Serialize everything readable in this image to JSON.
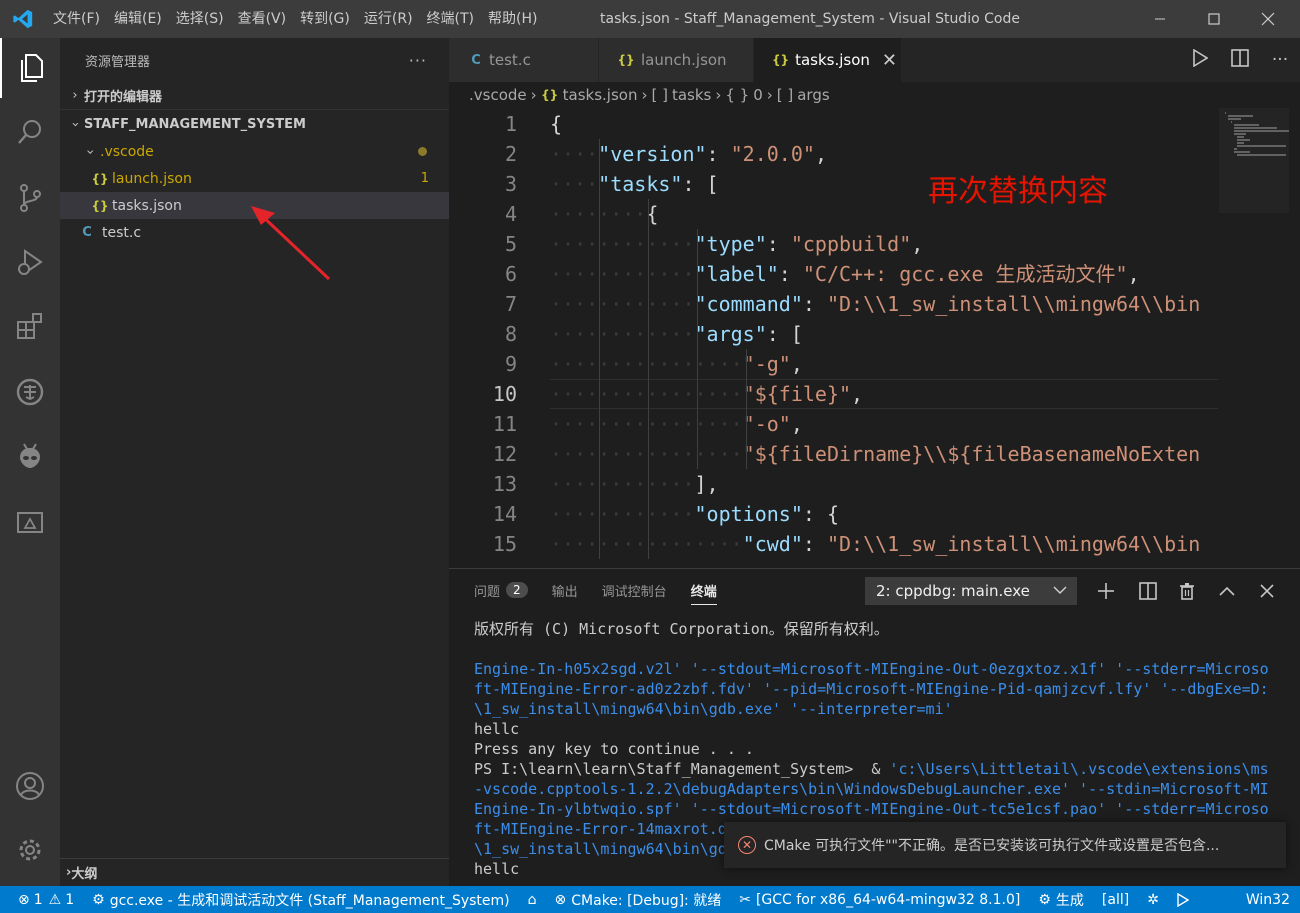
{
  "window": {
    "title": "tasks.json - Staff_Management_System - Visual Studio Code",
    "menu": [
      "文件(F)",
      "编辑(E)",
      "选择(S)",
      "查看(V)",
      "转到(G)",
      "运行(R)",
      "终端(T)",
      "帮助(H)"
    ]
  },
  "activity_bar": [
    "explorer-icon",
    "search-icon",
    "source-control-icon",
    "run-debug-icon",
    "extensions-icon",
    "remote-icon",
    "alien-icon",
    "cmake-icon",
    "account-icon",
    "settings-gear-icon"
  ],
  "sidebar": {
    "header": "资源管理器",
    "more": "···",
    "open_editors": "打开的编辑器",
    "project": "STAFF_MANAGEMENT_SYSTEM",
    "folder": ".vscode",
    "files": {
      "launch": "launch.json",
      "launch_badge": "1",
      "tasks": "tasks.json",
      "testc": "test.c"
    },
    "outline": "大纲"
  },
  "tabs": [
    {
      "label": "test.c",
      "icon": "C"
    },
    {
      "label": "launch.json",
      "icon": "{}"
    },
    {
      "label": "tasks.json",
      "icon": "{}",
      "close": "✕"
    }
  ],
  "breadcrumb": {
    "folder": ".vscode",
    "file": "tasks.json",
    "tasks": "tasks",
    "index": "0",
    "args": "args"
  },
  "editor": {
    "annotation": "再次替换内容",
    "current_line": 10,
    "lines": [
      {
        "n": "1",
        "ind": 0,
        "parts": [
          [
            "p",
            "{"
          ]
        ]
      },
      {
        "n": "2",
        "ind": 1,
        "parts": [
          [
            "k",
            "\"version\""
          ],
          [
            "p",
            ": "
          ],
          [
            "s",
            "\"2.0.0\""
          ],
          [
            "p",
            ","
          ]
        ]
      },
      {
        "n": "3",
        "ind": 1,
        "parts": [
          [
            "k",
            "\"tasks\""
          ],
          [
            "p",
            ": ["
          ]
        ]
      },
      {
        "n": "4",
        "ind": 2,
        "parts": [
          [
            "p",
            "{"
          ]
        ]
      },
      {
        "n": "5",
        "ind": 3,
        "parts": [
          [
            "k",
            "\"type\""
          ],
          [
            "p",
            ": "
          ],
          [
            "s",
            "\"cppbuild\""
          ],
          [
            "p",
            ","
          ]
        ]
      },
      {
        "n": "6",
        "ind": 3,
        "parts": [
          [
            "k",
            "\"label\""
          ],
          [
            "p",
            ": "
          ],
          [
            "s",
            "\"C/C++: gcc.exe 生成活动文件\""
          ],
          [
            "p",
            ","
          ]
        ]
      },
      {
        "n": "7",
        "ind": 3,
        "parts": [
          [
            "k",
            "\"command\""
          ],
          [
            "p",
            ": "
          ],
          [
            "s",
            "\"D:\\\\1_sw_install\\\\mingw64\\\\bin"
          ]
        ]
      },
      {
        "n": "8",
        "ind": 3,
        "parts": [
          [
            "k",
            "\"args\""
          ],
          [
            "p",
            ": ["
          ]
        ]
      },
      {
        "n": "9",
        "ind": 4,
        "parts": [
          [
            "s",
            "\"-g\""
          ],
          [
            "p",
            ","
          ]
        ]
      },
      {
        "n": "10",
        "ind": 4,
        "parts": [
          [
            "s",
            "\"${file}\""
          ],
          [
            "p",
            ","
          ]
        ]
      },
      {
        "n": "11",
        "ind": 4,
        "parts": [
          [
            "s",
            "\"-o\""
          ],
          [
            "p",
            ","
          ]
        ]
      },
      {
        "n": "12",
        "ind": 4,
        "parts": [
          [
            "s",
            "\"${fileDirname}\\\\${fileBasenameNoExten"
          ]
        ]
      },
      {
        "n": "13",
        "ind": 3,
        "parts": [
          [
            "p",
            "],"
          ]
        ]
      },
      {
        "n": "14",
        "ind": 3,
        "parts": [
          [
            "k",
            "\"options\""
          ],
          [
            "p",
            ": {"
          ]
        ]
      },
      {
        "n": "15",
        "ind": 4,
        "parts": [
          [
            "k",
            "\"cwd\""
          ],
          [
            "p",
            ": "
          ],
          [
            "s",
            "\"D:\\\\1_sw_install\\\\mingw64\\\\bin"
          ]
        ]
      }
    ]
  },
  "panel": {
    "tabs": {
      "problems": "问题",
      "problems_count": "2",
      "output": "输出",
      "debug_console": "调试控制台",
      "terminal": "终端"
    },
    "terminal_select": "2: cppdbg: main.exe",
    "terminal_lines": [
      {
        "c": "n",
        "t": "版权所有 (C) Microsoft Corporation。保留所有权利。"
      },
      {
        "c": "n",
        "t": ""
      },
      {
        "c": "b",
        "t": "Engine-In-h05x2sgd.v2l' '--stdout=Microsoft-MIEngine-Out-0ezgxtoz.x1f' '--stderr=Microso"
      },
      {
        "c": "b",
        "t": "ft-MIEngine-Error-ad0z2zbf.fdv' '--pid=Microsoft-MIEngine-Pid-qamjzcvf.lfy' '--dbgExe=D:"
      },
      {
        "c": "b",
        "t": "\\1_sw_install\\mingw64\\bin\\gdb.exe' '--interpreter=mi'"
      },
      {
        "c": "n",
        "t": "hellc"
      },
      {
        "c": "n",
        "t": "Press any key to continue . . ."
      },
      {
        "c": "m",
        "t": "PS I:\\learn\\learn\\Staff_Management_System>  & ",
        "t2": "'c:\\Users\\Littletail\\.vscode\\extensions\\ms"
      },
      {
        "c": "b",
        "t": "-vscode.cpptools-1.2.2\\debugAdapters\\bin\\WindowsDebugLauncher.exe' '--stdin=Microsoft-MI"
      },
      {
        "c": "b",
        "t": "Engine-In-ylbtwqio.spf' '--stdout=Microsoft-MIEngine-Out-tc5e1csf.pao' '--stderr=Microso"
      },
      {
        "c": "b",
        "t": "ft-MIEngine-Error-14maxrot.d"
      },
      {
        "c": "b",
        "t": "\\1_sw_install\\mingw64\\bin\\gd"
      },
      {
        "c": "n",
        "t": "hellc"
      }
    ]
  },
  "notification": {
    "message": "CMake 可执行文件\"\"不正确。是否已安装该可执行文件或设置是否包含..."
  },
  "statusbar": {
    "errors": "1",
    "warnings": "1",
    "task": "gcc.exe - 生成和调试活动文件 (Staff_Management_System)",
    "cmake": "CMake: [Debug]: 就绪",
    "kit": "[GCC for x86_64-w64-mingw32 8.1.0]",
    "build": "生成",
    "target": "[all]",
    "platform": "Win32"
  },
  "colors": {
    "statusbar": "#007acc",
    "activitybar": "#333333",
    "sidebar": "#252526",
    "editor": "#1e1e1e",
    "annotation": "#e51400",
    "json_key": "#9cdcfe",
    "json_string": "#ce9178"
  }
}
